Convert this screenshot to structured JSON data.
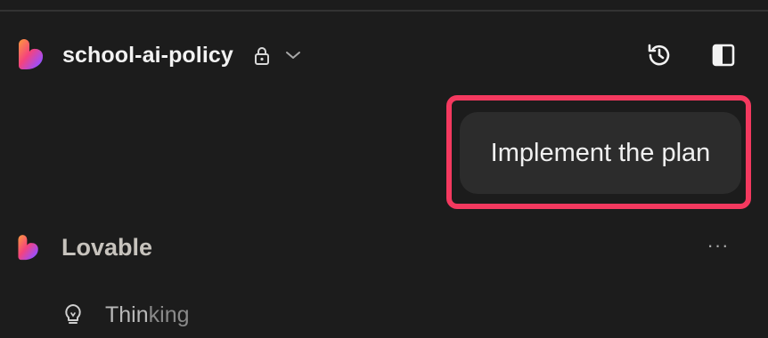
{
  "header": {
    "project_name": "school-ai-policy",
    "icons": {
      "logo": "lovable-heart-logo",
      "lock": "lock-icon",
      "dropdown": "chevron-down-icon",
      "history": "history-icon",
      "sidebar_toggle": "sidebar-toggle-icon"
    }
  },
  "chat": {
    "user_message": "Implement the plan",
    "assistant_name": "Lovable",
    "more_label": "···",
    "status_prefix": "Thin",
    "status_suffix": "king"
  },
  "colors": {
    "background": "#1c1c1c",
    "bubble": "#2c2c2c",
    "highlight": "#f4395f",
    "logo_gradient": [
      "#ff8a3d",
      "#f24a7a",
      "#8b5cf6",
      "#4f7cff"
    ]
  }
}
